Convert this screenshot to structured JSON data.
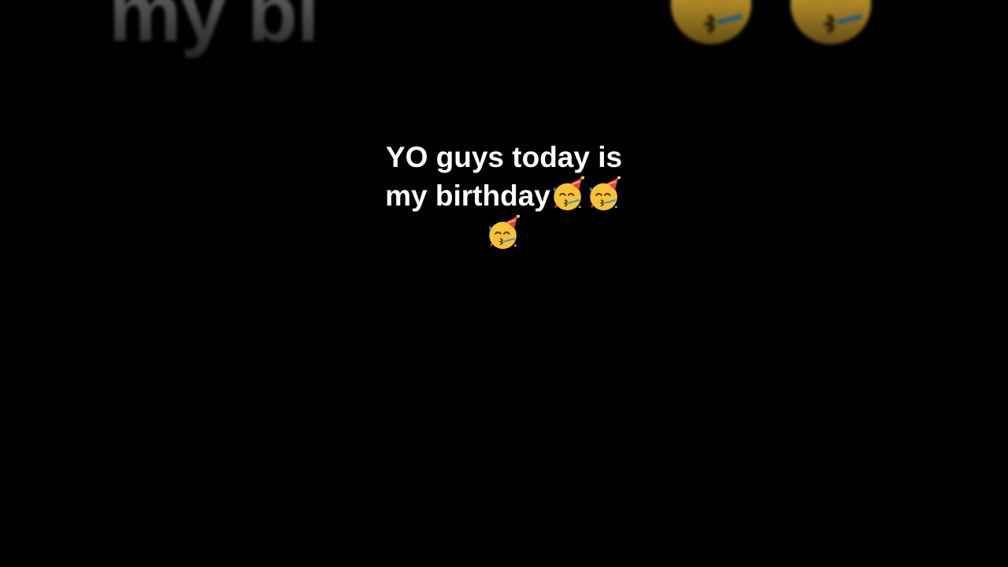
{
  "background": {
    "blurred_text": "my bi",
    "emoji_icon": "partying-face-icon"
  },
  "caption": {
    "line1": "YO guys today is",
    "line2": "my birthday",
    "emoji_icon": "partying-face-icon",
    "emoji_count": 3
  },
  "colors": {
    "background": "#000000",
    "text": "#ffffff",
    "blurred_text": "#5a5a5a",
    "emoji_face": "#f9c235",
    "party_hat": "#e0444b"
  }
}
